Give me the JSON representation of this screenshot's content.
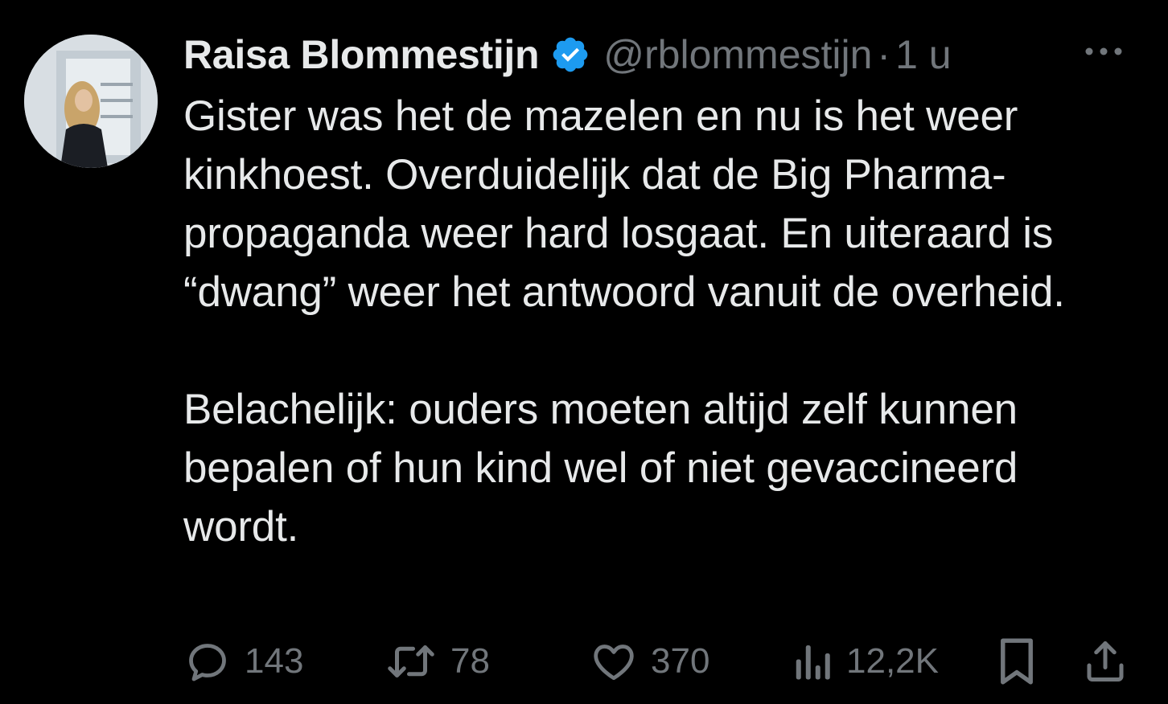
{
  "author": {
    "display_name": "Raisa Blommestijn",
    "handle": "@rblommestijn",
    "separator": "·",
    "time": "1 u",
    "verified_color": "#1d9bf0",
    "avatar_icon": "profile-photo"
  },
  "tweet": {
    "text": "Gister was het de mazelen en nu is het weer kinkhoest. Overduidelijk dat de Big Pharma-propaganda weer hard losgaat. En uiteraard is “dwang” weer het antwoord vanuit de overheid.\n\nBelachelijk: ouders moeten altijd zelf kunnen bepalen of hun kind wel of niet gevaccineerd wordt."
  },
  "actions": {
    "replies": "143",
    "retweets": "78",
    "likes": "370",
    "views": "12,2K"
  },
  "colors": {
    "background": "#000000",
    "text": "#e7e9ea",
    "muted": "#71767b"
  }
}
